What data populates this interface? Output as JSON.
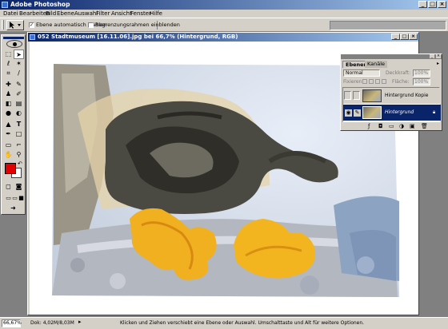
{
  "app": {
    "title": "Adobe Photoshop"
  },
  "menu": [
    "Datei",
    "Bearbeiten",
    "Bild",
    "Ebene",
    "Auswahl",
    "Filter",
    "Ansicht",
    "Fenster",
    "Hilfe"
  ],
  "options": {
    "auto_select_label": "Ebene automatisch wählen",
    "bounding_box_label": "Begrenzungsrahmen einblenden"
  },
  "document": {
    "title": "052 Stadtmuseum [16.11.06].jpg bei 66,7% (Hintergrund, RGB)"
  },
  "layers_palette": {
    "tabs": [
      "Ebenen",
      "Kanäle"
    ],
    "blend_mode": "Normal",
    "opacity_label": "Deckkraft:",
    "opacity_value": "100%",
    "lock_label": "Fixieren:",
    "fill_label": "Fläche:",
    "fill_value": "100%",
    "layers": [
      {
        "name": "Hintergrund Kopie",
        "selected": false
      },
      {
        "name": "Hintergrund",
        "selected": true
      }
    ]
  },
  "status": {
    "zoom": "66,67%",
    "doc_info": "Dok: 4,02M/8,03M",
    "hint": "Klicken und Ziehen verschiebt eine Ebene oder Auswahl. Umschalttaste und Alt für weitere Optionen."
  },
  "colors": {
    "foreground": "#e00000",
    "background": "#ffffff",
    "titlebar": "#0a246a",
    "selection": "#0a246a"
  },
  "icons": [
    "photoshop-icon",
    "move-tool-icon",
    "eye-icon",
    "brush-icon",
    "lock-icon",
    "trash-icon",
    "new-layer-icon"
  ]
}
